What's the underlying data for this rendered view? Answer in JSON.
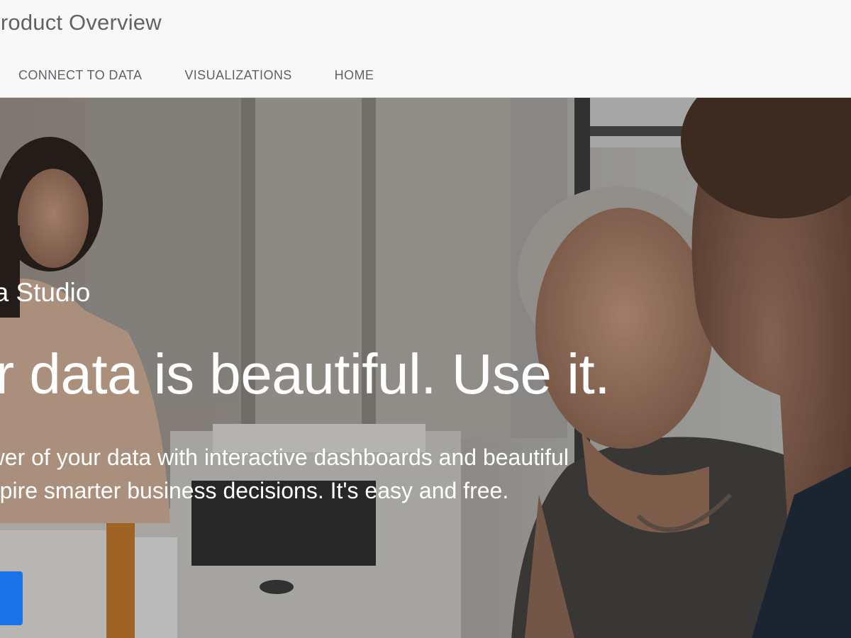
{
  "header": {
    "title": "Product Overview",
    "nav": [
      {
        "label": "CONNECT TO DATA"
      },
      {
        "label": "VISUALIZATIONS"
      },
      {
        "label": "HOME"
      }
    ]
  },
  "hero": {
    "eyebrow": "Data Studio",
    "headline": "Your data is beautiful. Use it.",
    "subtext_line1": "Unlock the power of your data with interactive dashboards and beautiful",
    "subtext_line2": "reports that inspire smarter business decisions. It's easy and free.",
    "cta_label": "",
    "accent_color": "#1a73e8"
  }
}
